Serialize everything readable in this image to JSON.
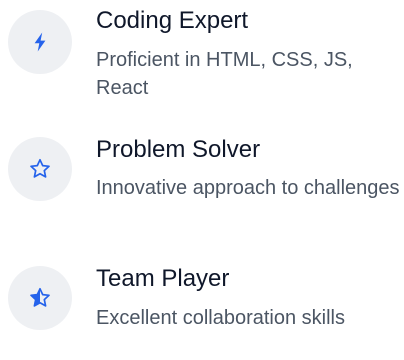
{
  "skills": [
    {
      "title": "Coding Expert",
      "description": "Proficient in HTML, CSS, JS, React",
      "icon": "lightning-bolt-icon"
    },
    {
      "title": "Problem Solver",
      "description": "Innovative approach to challenges",
      "icon": "star-outline-icon"
    },
    {
      "title": "Team Player",
      "description": "Excellent collaboration skills",
      "icon": "star-half-icon"
    }
  ],
  "colors": {
    "accent": "#2563eb",
    "icon_bg": "#eef0f3",
    "title": "#0f172a",
    "description": "#4b5563"
  }
}
